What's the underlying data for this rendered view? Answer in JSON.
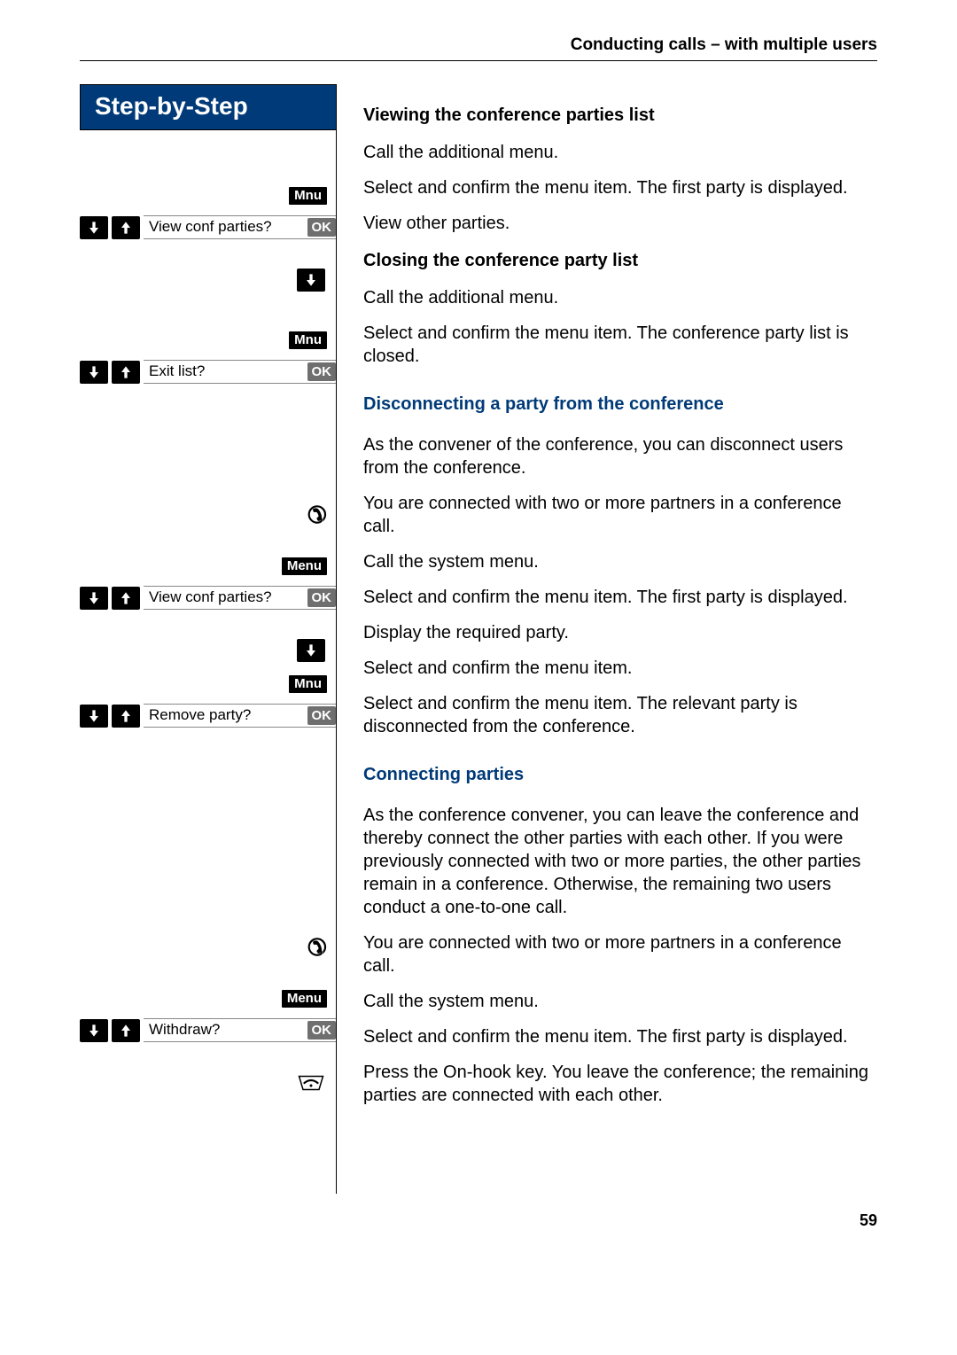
{
  "header": {
    "title": "Conducting calls – with multiple users"
  },
  "stepHeader": "Step-by-Step",
  "keys": {
    "mnu": "Mnu",
    "menu": "Menu",
    "ok": "OK"
  },
  "display": {
    "viewConfParties": "View conf parties?",
    "exitList": "Exit list?",
    "removeParty": "Remove party?",
    "withdraw": "Withdraw?"
  },
  "headings": {
    "viewingList": "Viewing the conference parties list",
    "closingList": "Closing the conference party list",
    "disconnecting": "Disconnecting a party from the conference",
    "connecting": "Connecting parties"
  },
  "text": {
    "callAdditionalMenu": "Call the additional menu.",
    "selectConfirmFirst": "Select and confirm the menu item. The first party is displayed.",
    "viewOther": "View other parties.",
    "selectConfirmClosed": "Select and confirm the menu item. The conference party list is closed.",
    "disconnectIntro": "As the convener of the conference, you can disconnect users from the conference.",
    "connectedTwoOrMore": "You are connected with two or more partners in a conference call.",
    "callSystemMenu": "Call the system menu.",
    "displayRequired": "Display the required party.",
    "selectConfirmItem": "Select and confirm the menu item.",
    "selectConfirmRemove": "Select and confirm the menu item. The relevant party is disconnected from the conference.",
    "connectingIntro": "As the conference convener, you can leave the conference and thereby connect the other parties with each other. If you were previously connected with two or more parties, the other parties remain in a conference. Otherwise, the remaining two users conduct a one-to-one call.",
    "pressOnHook": "Press the On-hook key. You leave the conference; the remaining parties are connected with each other."
  },
  "pageNumber": "59"
}
